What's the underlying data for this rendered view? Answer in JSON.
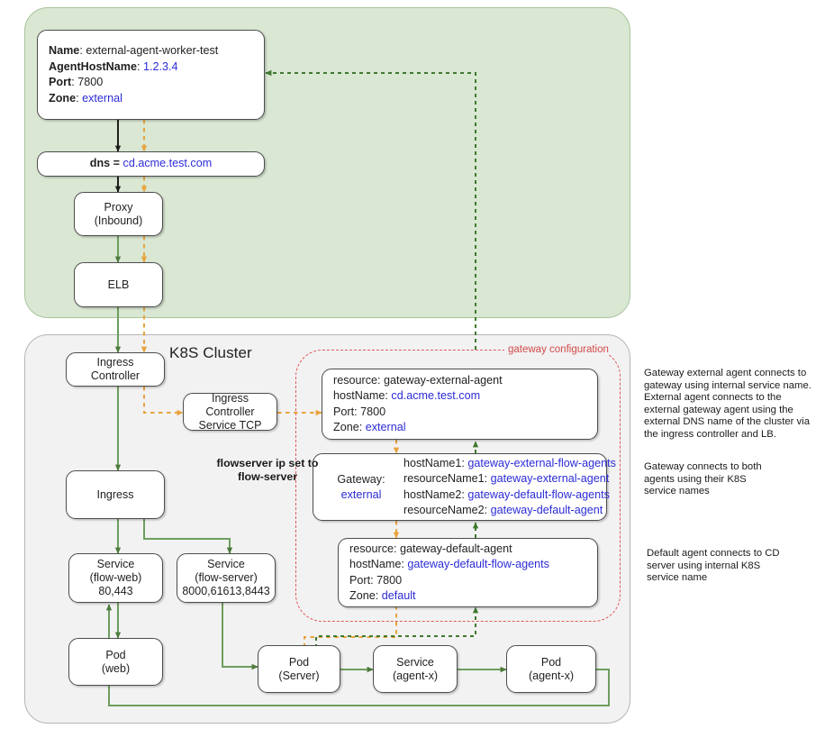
{
  "panels": {
    "external": {
      "title": ""
    },
    "cluster": {
      "title": "K8S Cluster"
    },
    "gateway_config": {
      "label": "gateway configuration"
    }
  },
  "nodes": {
    "external_agent": {
      "lines": [
        {
          "key": "Name",
          "sep": ":  ",
          "value": "external-agent-worker-test",
          "value_color": "dark"
        },
        {
          "key": "AgentHostName",
          "sep": ": ",
          "value": "1.2.3.4",
          "value_color": "blue"
        },
        {
          "key": "Port",
          "sep": ": ",
          "value": "7800",
          "value_color": "dark"
        },
        {
          "key": "Zone",
          "sep": ": ",
          "value": "external",
          "value_color": "blue"
        }
      ]
    },
    "dns": {
      "key": "dns = ",
      "value": "cd.acme.test.com"
    },
    "proxy": {
      "line1": "Proxy",
      "line2": "(Inbound)"
    },
    "elb": {
      "line1": "ELB"
    },
    "ingress_controller": {
      "line1": "Ingress Controller"
    },
    "ingress_controller_service": {
      "line1": "Ingress Controller",
      "line2": "Service TCP"
    },
    "ingress": {
      "line1": "Ingress"
    },
    "service_flow_web": {
      "line1": "Service",
      "line2": "(flow-web)",
      "line3": "80,443"
    },
    "service_flow_server": {
      "line1": "Service",
      "line2": "(flow-server)",
      "line3": "8000,61613,8443"
    },
    "pod_web": {
      "line1": "Pod",
      "line2": "(web)"
    },
    "pod_server": {
      "line1": "Pod",
      "line2": "(Server)"
    },
    "service_agent_x": {
      "line1": "Service",
      "line2": "(agent-x)"
    },
    "pod_agent_x": {
      "line1": "Pod",
      "line2": "(agent-x)"
    },
    "gateway_external_agent": {
      "lines": [
        {
          "key": "resource:",
          "sep": "  ",
          "value": "gateway-external-agent",
          "value_color": "dark"
        },
        {
          "key": "hostName:",
          "sep": " ",
          "value": "cd.acme.test.com",
          "value_color": "blue"
        },
        {
          "key": "Port:",
          "sep": " ",
          "value": "7800",
          "value_color": "dark"
        },
        {
          "key": "Zone:",
          "sep": " ",
          "value": "external",
          "value_color": "blue"
        }
      ]
    },
    "gateway": {
      "label_line1": "Gateway:",
      "label_line2": "external",
      "lines": [
        {
          "key": "hostName1:",
          "sep": " ",
          "value": "gateway-external-flow-agents",
          "value_color": "blue"
        },
        {
          "key": "resourceName1:",
          "sep": " ",
          "value": "gateway-external-agent",
          "value_color": "blue"
        },
        {
          "key": "hostName2:",
          "sep": " ",
          "value": "gateway-default-flow-agents",
          "value_color": "blue"
        },
        {
          "key": "resourceName2:",
          "sep": " ",
          "value": "gateway-default-agent",
          "value_color": "blue"
        }
      ]
    },
    "gateway_default_agent": {
      "lines": [
        {
          "key": "resource:",
          "sep": "  ",
          "value": "gateway-default-agent",
          "value_color": "dark"
        },
        {
          "key": "hostName:",
          "sep": " ",
          "value": "gateway-default-flow-agents",
          "value_color": "blue"
        },
        {
          "key": "Port:",
          "sep": " ",
          "value": "7800",
          "value_color": "dark"
        },
        {
          "key": "Zone:",
          "sep": " ",
          "value": "default",
          "value_color": "blue"
        }
      ]
    }
  },
  "callouts": {
    "flowserver_ip": "flowserver ip set to\nflow-server"
  },
  "notes": {
    "note1": "Gateway external agent connects to gateway using internal service name. External agent connects to the external gateway agent using the external DNS name of the cluster via the ingress controller and LB.",
    "note2": "Gateway connects to both agents using their K8S service names",
    "note3": "Default agent connects to CD server using internal K8S service name"
  },
  "colors": {
    "panel_external_fill": "#d9e7d3",
    "panel_external_border": "#a9c49c",
    "panel_cluster_fill": "#f2f2f2",
    "panel_cluster_border": "#b6b6b6",
    "flow_green": "#6d9e5e",
    "dashed_green": "#3f7a2e",
    "dashed_orange": "#e8a33d",
    "dashed_red": "#e05a5a",
    "link_blue": "#2b2bd6",
    "box_border": "#4d4d4d"
  }
}
